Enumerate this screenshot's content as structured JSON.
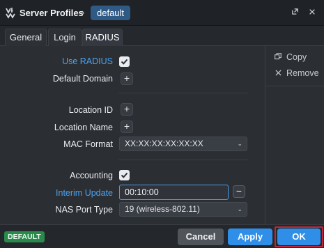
{
  "window": {
    "title": "Server Profiles",
    "breadcrumb_sep": "›",
    "breadcrumb_current": "default",
    "icons": [
      "app-logo-icon",
      "popout-icon",
      "close-icon"
    ]
  },
  "tabs": [
    {
      "label": "General",
      "active": false
    },
    {
      "label": "Login",
      "active": false
    },
    {
      "label": "RADIUS",
      "active": true
    }
  ],
  "form": {
    "use_radius": {
      "label": "Use RADIUS",
      "checked": true
    },
    "default_domain": {
      "label": "Default Domain"
    },
    "location_id": {
      "label": "Location ID"
    },
    "location_name": {
      "label": "Location Name"
    },
    "mac_format": {
      "label": "MAC Format",
      "value": "XX:XX:XX:XX:XX:XX"
    },
    "accounting": {
      "label": "Accounting",
      "checked": true
    },
    "interim_update": {
      "label": "Interim Update",
      "value": "00:10:00"
    },
    "nas_port_type": {
      "label": "NAS Port Type",
      "value": "19 (wireless-802.11)"
    }
  },
  "side_actions": {
    "copy": "Copy",
    "remove": "Remove"
  },
  "footer": {
    "badge": "DEFAULT",
    "cancel": "Cancel",
    "apply": "Apply",
    "ok": "OK"
  },
  "colors": {
    "accent": "#2f8fe8",
    "label_highlight": "#4aa3f0",
    "badge": "#2a8a4b",
    "focus_outline": "#c0283a"
  }
}
